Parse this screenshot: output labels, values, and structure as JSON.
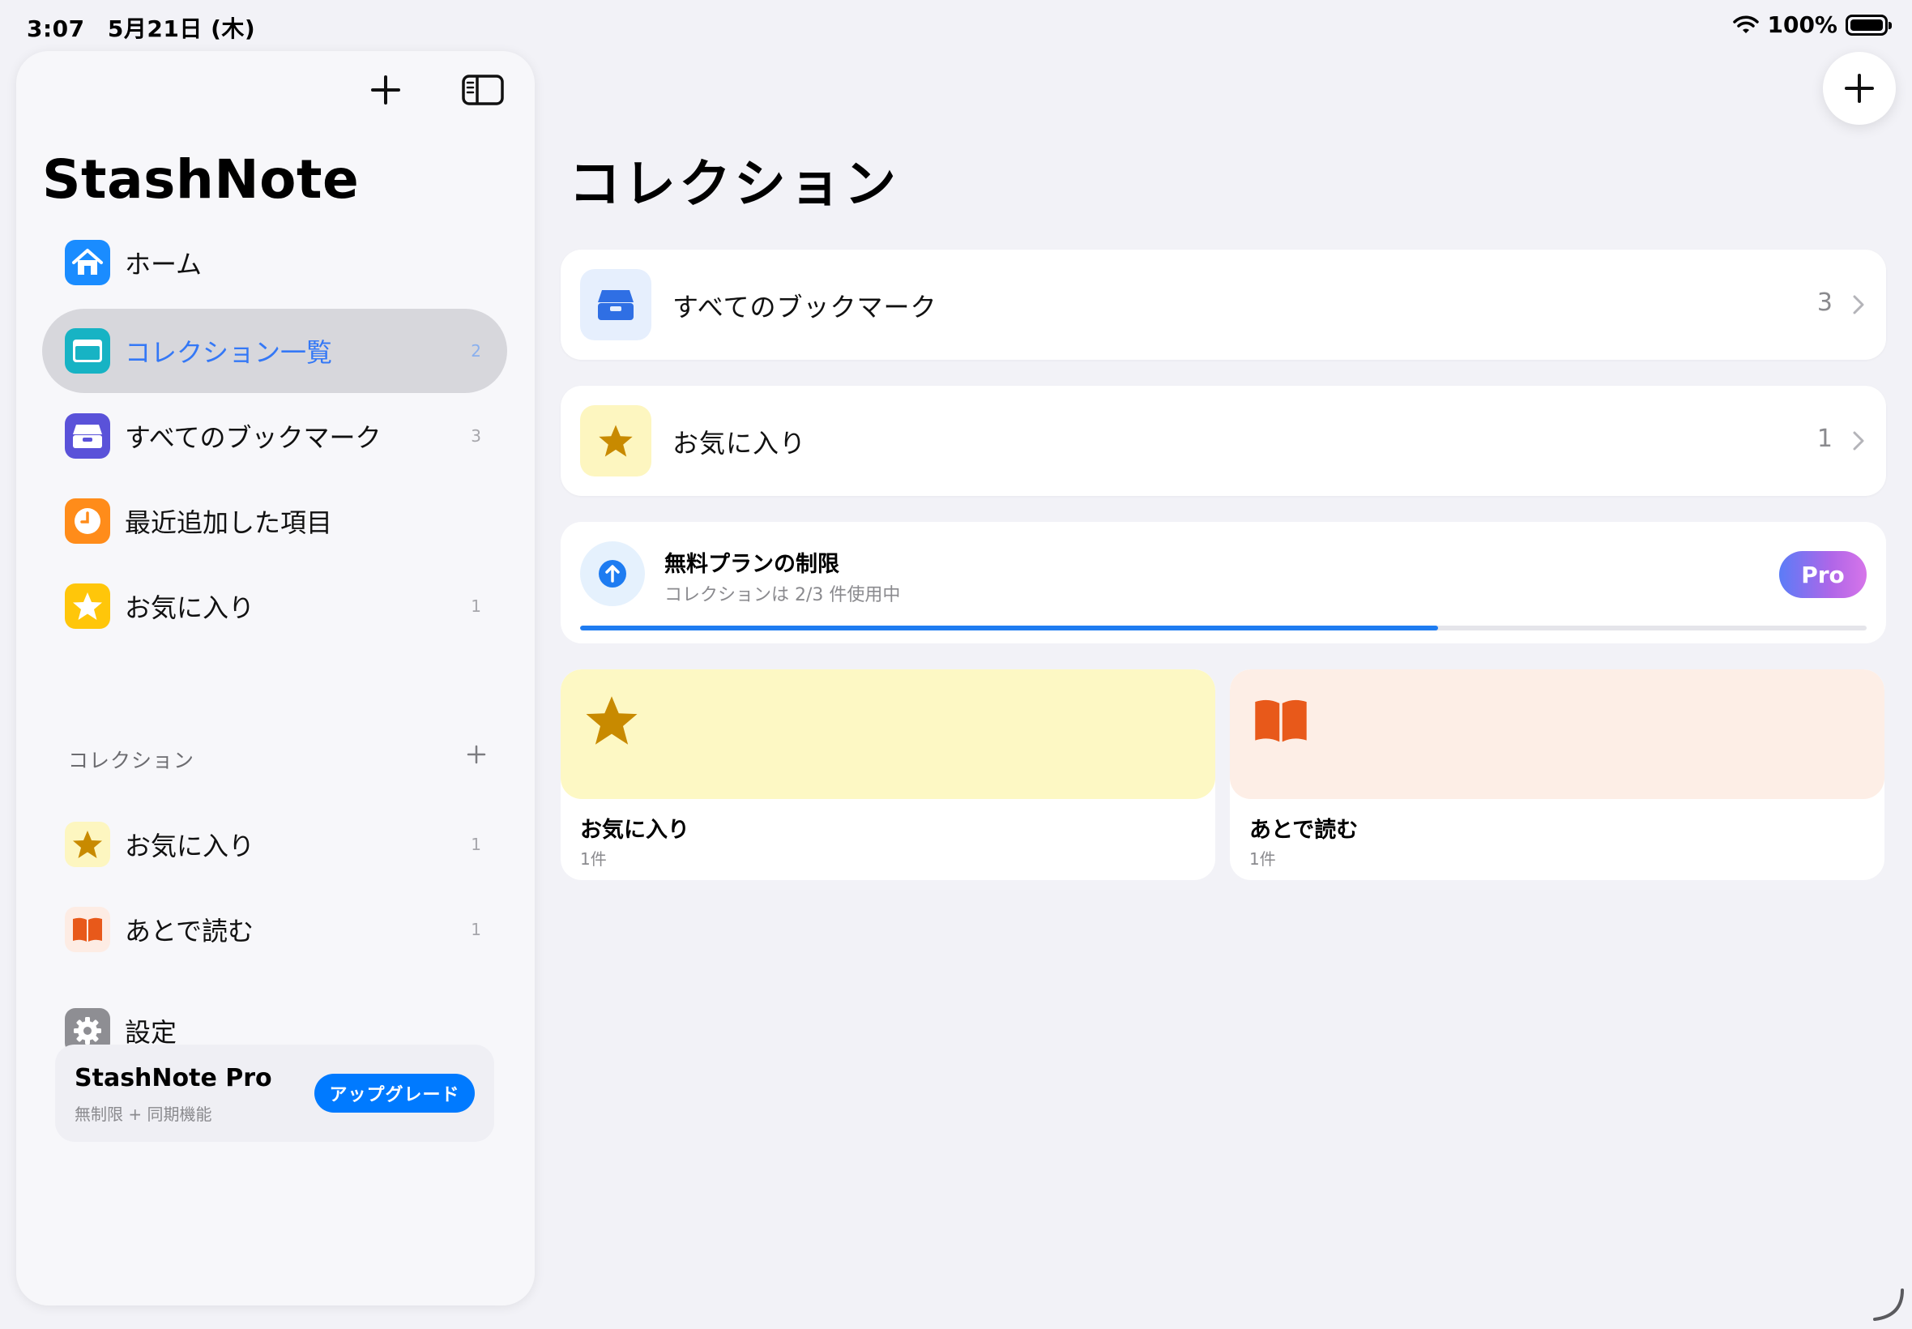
{
  "status_bar": {
    "time": "3:07",
    "date": "5月21日 (木)",
    "battery": "100%"
  },
  "sidebar": {
    "app_title": "StashNote",
    "nav": [
      {
        "label": "ホーム",
        "count": "",
        "icon": "house-icon",
        "color": "#1a8cff"
      },
      {
        "label": "コレクション一覧",
        "count": "2",
        "icon": "folder-icon",
        "color": "#17b3c4"
      },
      {
        "label": "すべてのブックマーク",
        "count": "3",
        "icon": "tray-icon",
        "color": "#5a52d9"
      },
      {
        "label": "最近追加した項目",
        "count": "",
        "icon": "clock-icon",
        "color": "#ff8c1a"
      },
      {
        "label": "お気に入り",
        "count": "1",
        "icon": "star-icon",
        "color": "#ffc60a"
      }
    ],
    "section_title": "コレクション",
    "collections": [
      {
        "label": "お気に入り",
        "count": "1",
        "icon": "star-icon",
        "bg": "#fdf6c0",
        "color": "#c88a00"
      },
      {
        "label": "あとで読む",
        "count": "1",
        "icon": "book-icon",
        "bg": "#fdece4",
        "color": "#e8591a"
      }
    ],
    "settings_label": "設定",
    "pro_card": {
      "title": "StashNote Pro",
      "subtitle": "無制限 + 同期機能",
      "button": "アップグレード"
    }
  },
  "main": {
    "title": "コレクション",
    "rows": [
      {
        "label": "すべてのブックマーク",
        "count": "3",
        "icon": "tray-icon"
      },
      {
        "label": "お気に入り",
        "count": "1",
        "icon": "star-icon"
      }
    ],
    "limit": {
      "title": "無料プランの制限",
      "subtitle": "コレクションは 2/3 件使用中",
      "badge": "Pro",
      "progress": 0.667
    },
    "tiles": [
      {
        "name": "お気に入り",
        "count": "1件",
        "icon": "star-icon",
        "bg": "#fdf8c4",
        "color": "#c88a00"
      },
      {
        "name": "あとで読む",
        "count": "1件",
        "icon": "book-icon",
        "bg": "#fdeee6",
        "color": "#e8591a"
      }
    ]
  },
  "colors": {
    "accent": "#007aff",
    "background": "#f2f2f7",
    "active_nav": "#d7d7dc"
  }
}
